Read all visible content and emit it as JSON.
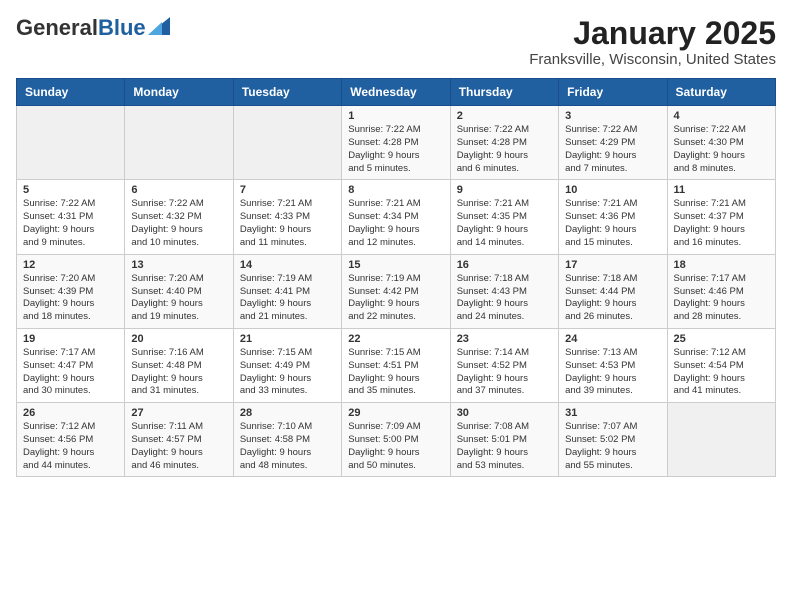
{
  "header": {
    "logo_general": "General",
    "logo_blue": "Blue",
    "month_title": "January 2025",
    "location": "Franksville, Wisconsin, United States"
  },
  "weekdays": [
    "Sunday",
    "Monday",
    "Tuesday",
    "Wednesday",
    "Thursday",
    "Friday",
    "Saturday"
  ],
  "weeks": [
    [
      {
        "day": "",
        "info": ""
      },
      {
        "day": "",
        "info": ""
      },
      {
        "day": "",
        "info": ""
      },
      {
        "day": "1",
        "info": "Sunrise: 7:22 AM\nSunset: 4:28 PM\nDaylight: 9 hours\nand 5 minutes."
      },
      {
        "day": "2",
        "info": "Sunrise: 7:22 AM\nSunset: 4:28 PM\nDaylight: 9 hours\nand 6 minutes."
      },
      {
        "day": "3",
        "info": "Sunrise: 7:22 AM\nSunset: 4:29 PM\nDaylight: 9 hours\nand 7 minutes."
      },
      {
        "day": "4",
        "info": "Sunrise: 7:22 AM\nSunset: 4:30 PM\nDaylight: 9 hours\nand 8 minutes."
      }
    ],
    [
      {
        "day": "5",
        "info": "Sunrise: 7:22 AM\nSunset: 4:31 PM\nDaylight: 9 hours\nand 9 minutes."
      },
      {
        "day": "6",
        "info": "Sunrise: 7:22 AM\nSunset: 4:32 PM\nDaylight: 9 hours\nand 10 minutes."
      },
      {
        "day": "7",
        "info": "Sunrise: 7:21 AM\nSunset: 4:33 PM\nDaylight: 9 hours\nand 11 minutes."
      },
      {
        "day": "8",
        "info": "Sunrise: 7:21 AM\nSunset: 4:34 PM\nDaylight: 9 hours\nand 12 minutes."
      },
      {
        "day": "9",
        "info": "Sunrise: 7:21 AM\nSunset: 4:35 PM\nDaylight: 9 hours\nand 14 minutes."
      },
      {
        "day": "10",
        "info": "Sunrise: 7:21 AM\nSunset: 4:36 PM\nDaylight: 9 hours\nand 15 minutes."
      },
      {
        "day": "11",
        "info": "Sunrise: 7:21 AM\nSunset: 4:37 PM\nDaylight: 9 hours\nand 16 minutes."
      }
    ],
    [
      {
        "day": "12",
        "info": "Sunrise: 7:20 AM\nSunset: 4:39 PM\nDaylight: 9 hours\nand 18 minutes."
      },
      {
        "day": "13",
        "info": "Sunrise: 7:20 AM\nSunset: 4:40 PM\nDaylight: 9 hours\nand 19 minutes."
      },
      {
        "day": "14",
        "info": "Sunrise: 7:19 AM\nSunset: 4:41 PM\nDaylight: 9 hours\nand 21 minutes."
      },
      {
        "day": "15",
        "info": "Sunrise: 7:19 AM\nSunset: 4:42 PM\nDaylight: 9 hours\nand 22 minutes."
      },
      {
        "day": "16",
        "info": "Sunrise: 7:18 AM\nSunset: 4:43 PM\nDaylight: 9 hours\nand 24 minutes."
      },
      {
        "day": "17",
        "info": "Sunrise: 7:18 AM\nSunset: 4:44 PM\nDaylight: 9 hours\nand 26 minutes."
      },
      {
        "day": "18",
        "info": "Sunrise: 7:17 AM\nSunset: 4:46 PM\nDaylight: 9 hours\nand 28 minutes."
      }
    ],
    [
      {
        "day": "19",
        "info": "Sunrise: 7:17 AM\nSunset: 4:47 PM\nDaylight: 9 hours\nand 30 minutes."
      },
      {
        "day": "20",
        "info": "Sunrise: 7:16 AM\nSunset: 4:48 PM\nDaylight: 9 hours\nand 31 minutes."
      },
      {
        "day": "21",
        "info": "Sunrise: 7:15 AM\nSunset: 4:49 PM\nDaylight: 9 hours\nand 33 minutes."
      },
      {
        "day": "22",
        "info": "Sunrise: 7:15 AM\nSunset: 4:51 PM\nDaylight: 9 hours\nand 35 minutes."
      },
      {
        "day": "23",
        "info": "Sunrise: 7:14 AM\nSunset: 4:52 PM\nDaylight: 9 hours\nand 37 minutes."
      },
      {
        "day": "24",
        "info": "Sunrise: 7:13 AM\nSunset: 4:53 PM\nDaylight: 9 hours\nand 39 minutes."
      },
      {
        "day": "25",
        "info": "Sunrise: 7:12 AM\nSunset: 4:54 PM\nDaylight: 9 hours\nand 41 minutes."
      }
    ],
    [
      {
        "day": "26",
        "info": "Sunrise: 7:12 AM\nSunset: 4:56 PM\nDaylight: 9 hours\nand 44 minutes."
      },
      {
        "day": "27",
        "info": "Sunrise: 7:11 AM\nSunset: 4:57 PM\nDaylight: 9 hours\nand 46 minutes."
      },
      {
        "day": "28",
        "info": "Sunrise: 7:10 AM\nSunset: 4:58 PM\nDaylight: 9 hours\nand 48 minutes."
      },
      {
        "day": "29",
        "info": "Sunrise: 7:09 AM\nSunset: 5:00 PM\nDaylight: 9 hours\nand 50 minutes."
      },
      {
        "day": "30",
        "info": "Sunrise: 7:08 AM\nSunset: 5:01 PM\nDaylight: 9 hours\nand 53 minutes."
      },
      {
        "day": "31",
        "info": "Sunrise: 7:07 AM\nSunset: 5:02 PM\nDaylight: 9 hours\nand 55 minutes."
      },
      {
        "day": "",
        "info": ""
      }
    ]
  ]
}
